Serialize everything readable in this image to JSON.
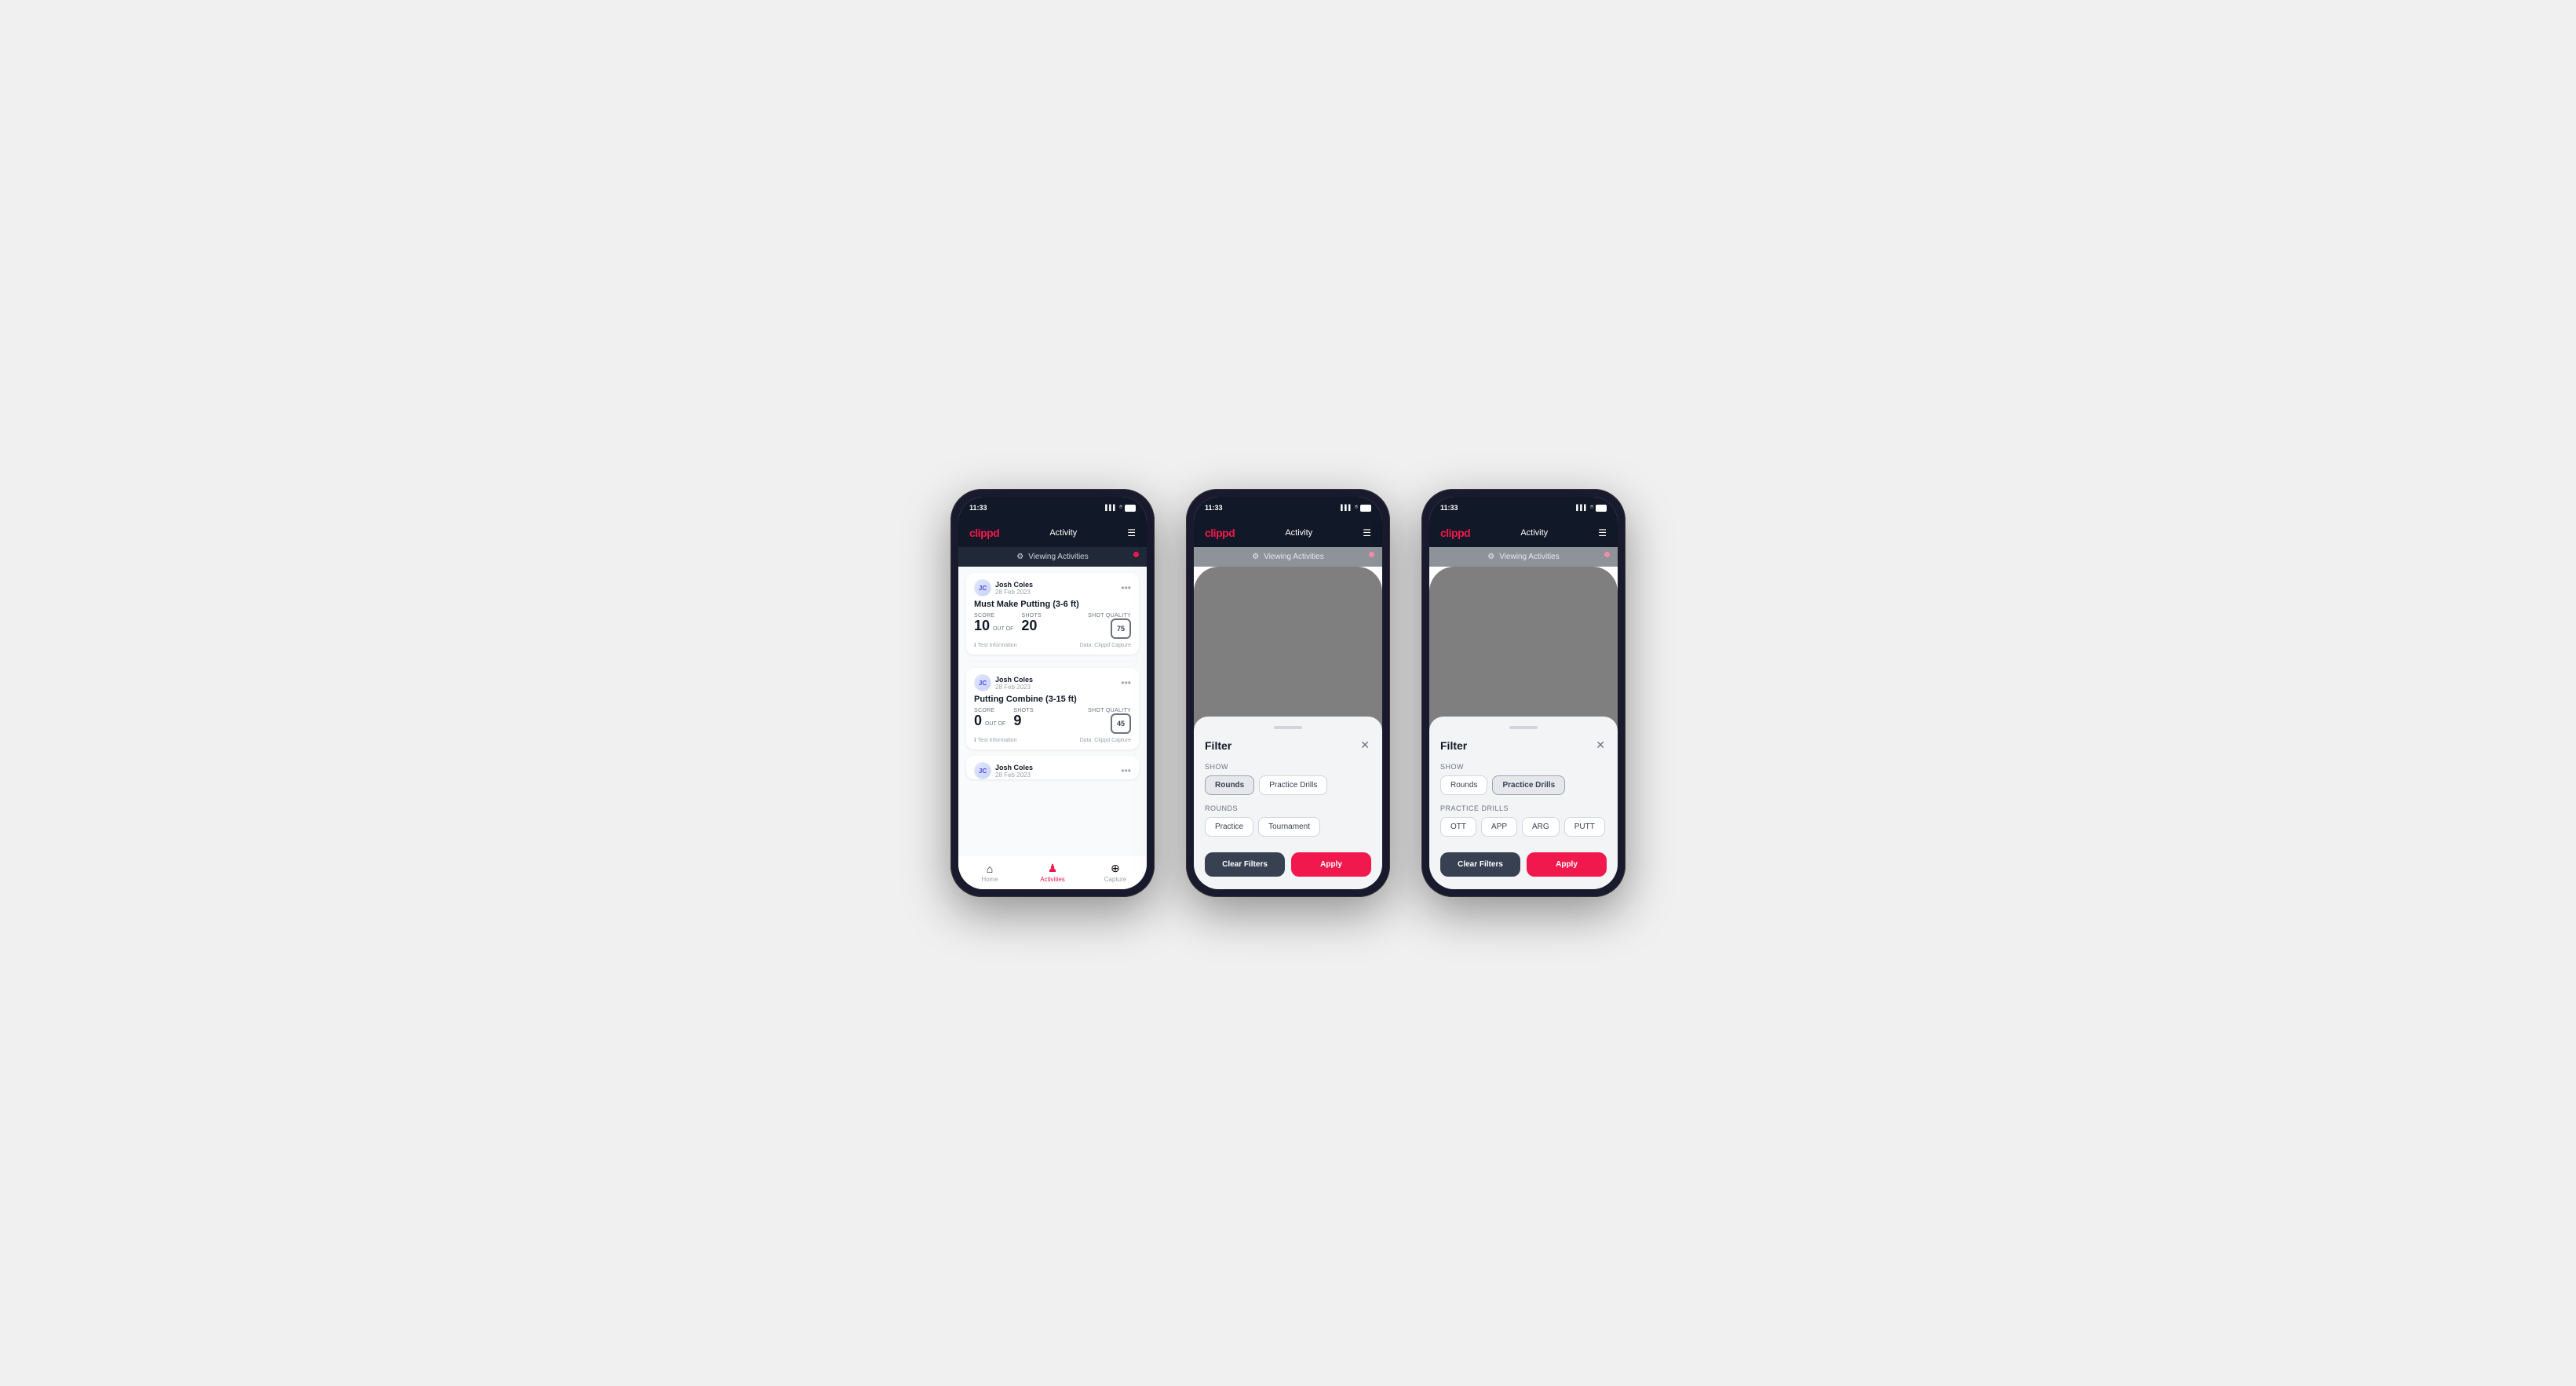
{
  "phones": [
    {
      "id": "phone1",
      "type": "activity",
      "status": {
        "time": "11:33",
        "signal": "▌▌▌",
        "wifi": "WiFi",
        "battery": "51"
      },
      "header": {
        "logo": "clippd",
        "title": "Activity",
        "menu_icon": "☰"
      },
      "banner": {
        "icon": "⚙",
        "text": "Viewing Activities"
      },
      "activities": [
        {
          "user_name": "Josh Coles",
          "user_date": "28 Feb 2023",
          "title": "Must Make Putting (3-6 ft)",
          "score_label": "Score",
          "score_value": "10",
          "out_of_label": "OUT OF",
          "shots_label": "Shots",
          "shots_value": "20",
          "shot_quality_label": "Shot Quality",
          "shot_quality_value": "75",
          "info_label": "Test Information",
          "data_label": "Data: Clippd Capture"
        },
        {
          "user_name": "Josh Coles",
          "user_date": "28 Feb 2023",
          "title": "Putting Combine (3-15 ft)",
          "score_label": "Score",
          "score_value": "0",
          "out_of_label": "OUT OF",
          "shots_label": "Shots",
          "shots_value": "9",
          "shot_quality_label": "Shot Quality",
          "shot_quality_value": "45",
          "info_label": "Test Information",
          "data_label": "Data: Clippd Capture"
        },
        {
          "user_name": "Josh Coles",
          "user_date": "28 Feb 2023",
          "title": "",
          "score_label": "",
          "score_value": "",
          "out_of_label": "",
          "shots_label": "",
          "shots_value": "",
          "shot_quality_label": "",
          "shot_quality_value": "",
          "info_label": "",
          "data_label": ""
        }
      ],
      "nav": {
        "items": [
          {
            "label": "Home",
            "icon": "⌂",
            "active": false
          },
          {
            "label": "Activities",
            "icon": "♟",
            "active": true
          },
          {
            "label": "Capture",
            "icon": "⊕",
            "active": false
          }
        ]
      }
    },
    {
      "id": "phone2",
      "type": "filter_rounds",
      "status": {
        "time": "11:33",
        "signal": "▌▌▌",
        "wifi": "WiFi",
        "battery": "51"
      },
      "header": {
        "logo": "clippd",
        "title": "Activity",
        "menu_icon": "☰"
      },
      "banner": {
        "icon": "⚙",
        "text": "Viewing Activities"
      },
      "filter": {
        "title": "Filter",
        "show_label": "Show",
        "show_options": [
          {
            "label": "Rounds",
            "active": true
          },
          {
            "label": "Practice Drills",
            "active": false
          }
        ],
        "rounds_label": "Rounds",
        "rounds_options": [
          {
            "label": "Practice",
            "active": false
          },
          {
            "label": "Tournament",
            "active": false
          }
        ],
        "clear_label": "Clear Filters",
        "apply_label": "Apply"
      }
    },
    {
      "id": "phone3",
      "type": "filter_drills",
      "status": {
        "time": "11:33",
        "signal": "▌▌▌",
        "wifi": "WiFi",
        "battery": "51"
      },
      "header": {
        "logo": "clippd",
        "title": "Activity",
        "menu_icon": "☰"
      },
      "banner": {
        "icon": "⚙",
        "text": "Viewing Activities"
      },
      "filter": {
        "title": "Filter",
        "show_label": "Show",
        "show_options": [
          {
            "label": "Rounds",
            "active": false
          },
          {
            "label": "Practice Drills",
            "active": true
          }
        ],
        "drills_label": "Practice Drills",
        "drills_options": [
          {
            "label": "OTT",
            "active": false
          },
          {
            "label": "APP",
            "active": false
          },
          {
            "label": "ARG",
            "active": false
          },
          {
            "label": "PUTT",
            "active": false
          }
        ],
        "clear_label": "Clear Filters",
        "apply_label": "Apply"
      }
    }
  ]
}
